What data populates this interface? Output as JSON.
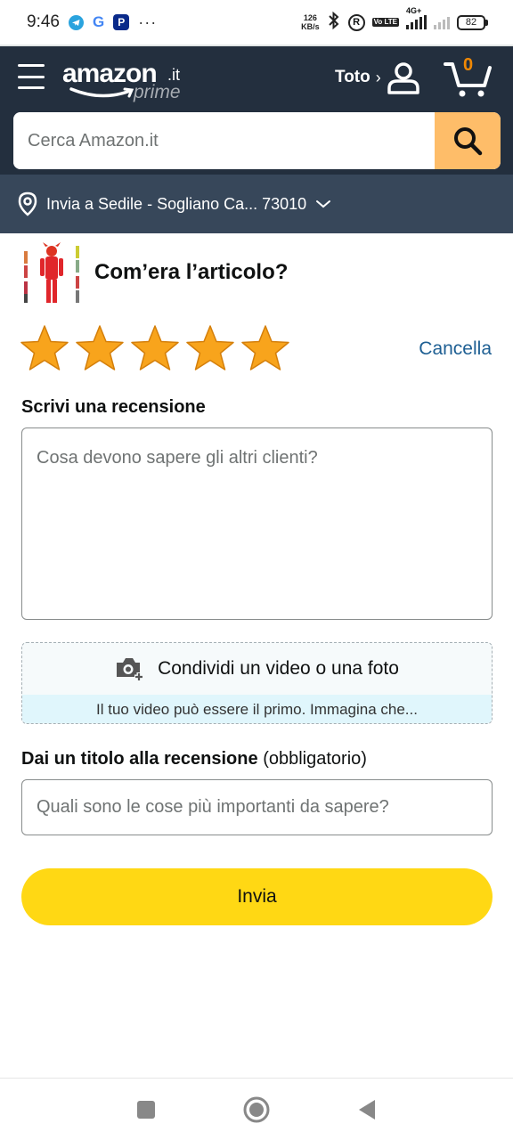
{
  "status_bar": {
    "time": "9:46",
    "more": "···",
    "speed_value": "126",
    "speed_unit": "KB/s",
    "network": "4G+",
    "volte": "Vo LTE",
    "battery": "82"
  },
  "header": {
    "logo_main": "amazon",
    "logo_tld": ".it",
    "logo_sub": "prime",
    "account_name": "Toto",
    "account_chevron": "›",
    "cart_count": "0",
    "search_placeholder": "Cerca Amazon.it",
    "deliver_to": "Invia a Sedile - Sogliano Ca... 73010"
  },
  "review": {
    "question": "Com’era l’articolo?",
    "rating": 5,
    "rating_max": 5,
    "cancel_label": "Cancella",
    "write_label": "Scrivi una recensione",
    "review_placeholder": "Cosa devono sapere gli altri clienti?",
    "media_label": "Condividi un video o una foto",
    "media_hint": "Il tuo video può essere il primo. Immagina che...",
    "title_label": "Dai un titolo alla recensione",
    "title_optional": "(obbligatorio)",
    "title_placeholder": "Quali sono le cose più importanti da sapere?",
    "submit_label": "Invia"
  },
  "colors": {
    "header_bg": "#232f3e",
    "deliver_bg": "#37475a",
    "search_button": "#febd69",
    "star": "#f8a41c",
    "submit": "#ffd814",
    "link": "#1e5f93"
  },
  "icons": [
    "telegram-icon",
    "google-icon",
    "paypal-icon",
    "bluetooth-icon",
    "registered-icon",
    "signal-icon",
    "battery-icon",
    "menu-icon",
    "user-icon",
    "cart-icon",
    "search-icon",
    "location-pin-icon",
    "chevron-down-icon",
    "star-icon",
    "camera-add-icon",
    "square-nav-icon",
    "home-nav-icon",
    "back-nav-icon"
  ]
}
